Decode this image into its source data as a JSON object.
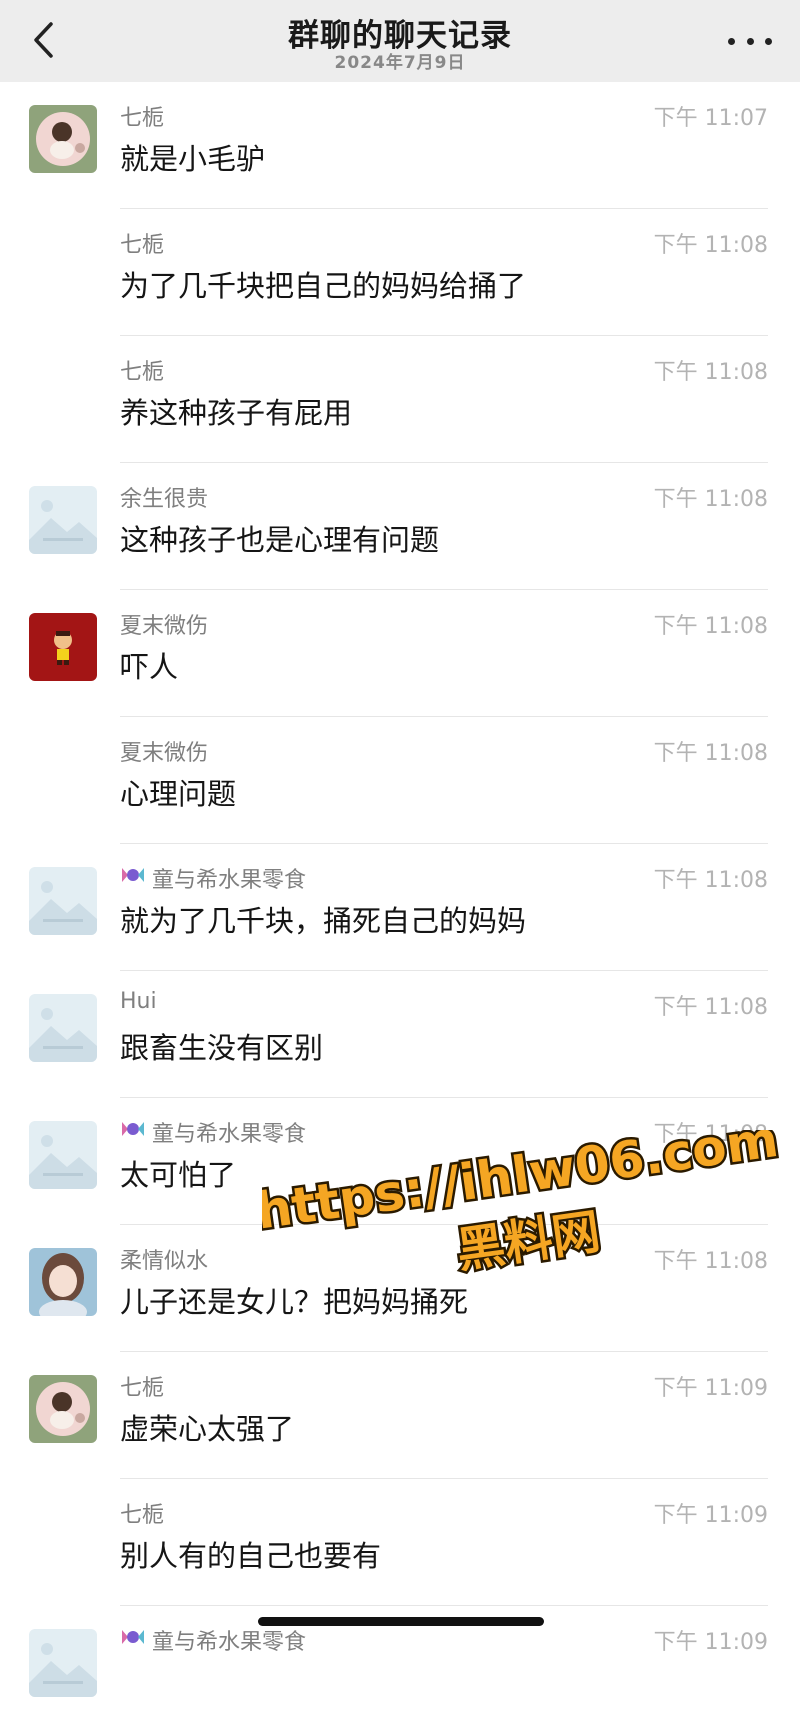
{
  "header": {
    "back_icon": "chevron-left-icon",
    "title": "群聊的聊天记录",
    "date": "2024年7月9日",
    "more_icon": "more-dots-icon"
  },
  "messages": [
    {
      "sender": "七栀",
      "time": "下午 11:07",
      "text": "就是小毛驴",
      "avatar": "avatar-qizhi",
      "show_avatar": true
    },
    {
      "sender": "七栀",
      "time": "下午 11:08",
      "text": "为了几千块把自己的妈妈给捅了",
      "show_avatar": false
    },
    {
      "sender": "七栀",
      "time": "下午 11:08",
      "text": "养这种孩子有屁用",
      "show_avatar": false
    },
    {
      "sender": "余生很贵",
      "time": "下午 11:08",
      "text": "这种孩子也是心理有问题",
      "avatar": "avatar-placeholder",
      "show_avatar": true
    },
    {
      "sender": "夏末微伤",
      "time": "下午 11:08",
      "text": "吓人",
      "avatar": "avatar-red-cartoon",
      "show_avatar": true
    },
    {
      "sender": "夏末微伤",
      "time": "下午 11:08",
      "text": "心理问题",
      "show_avatar": false
    },
    {
      "sender": "童与希水果零食",
      "time": "下午 11:08",
      "text": "就为了几千块，捅死自己的妈妈",
      "avatar": "avatar-placeholder",
      "show_avatar": true,
      "candy_icon": true
    },
    {
      "sender": "Hui",
      "time": "下午 11:08",
      "text": "跟畜生没有区别",
      "avatar": "avatar-placeholder",
      "show_avatar": true
    },
    {
      "sender": "童与希水果零食",
      "time": "下午 11:08",
      "text": "太可怕了",
      "avatar": "avatar-placeholder",
      "show_avatar": true,
      "candy_icon": true
    },
    {
      "sender": "柔情似水",
      "time": "下午 11:08",
      "text": "儿子还是女儿？把妈妈捅死",
      "avatar": "avatar-girl",
      "show_avatar": true
    },
    {
      "sender": "七栀",
      "time": "下午 11:09",
      "text": "虚荣心太强了",
      "avatar": "avatar-qizhi",
      "show_avatar": true
    },
    {
      "sender": "七栀",
      "time": "下午 11:09",
      "text": "别人有的自己也要有",
      "show_avatar": false
    },
    {
      "sender": "童与希水果零食",
      "time": "下午 11:09",
      "text": "",
      "avatar": "avatar-placeholder",
      "show_avatar": true,
      "candy_icon": true
    }
  ],
  "watermark": {
    "url": "https://ihlw06.com",
    "site": "黑料网"
  },
  "colors": {
    "header_bg": "#ededed",
    "sender": "#7f7f7f",
    "time": "#b3b3b3",
    "watermark_fill": "#f5a623"
  }
}
